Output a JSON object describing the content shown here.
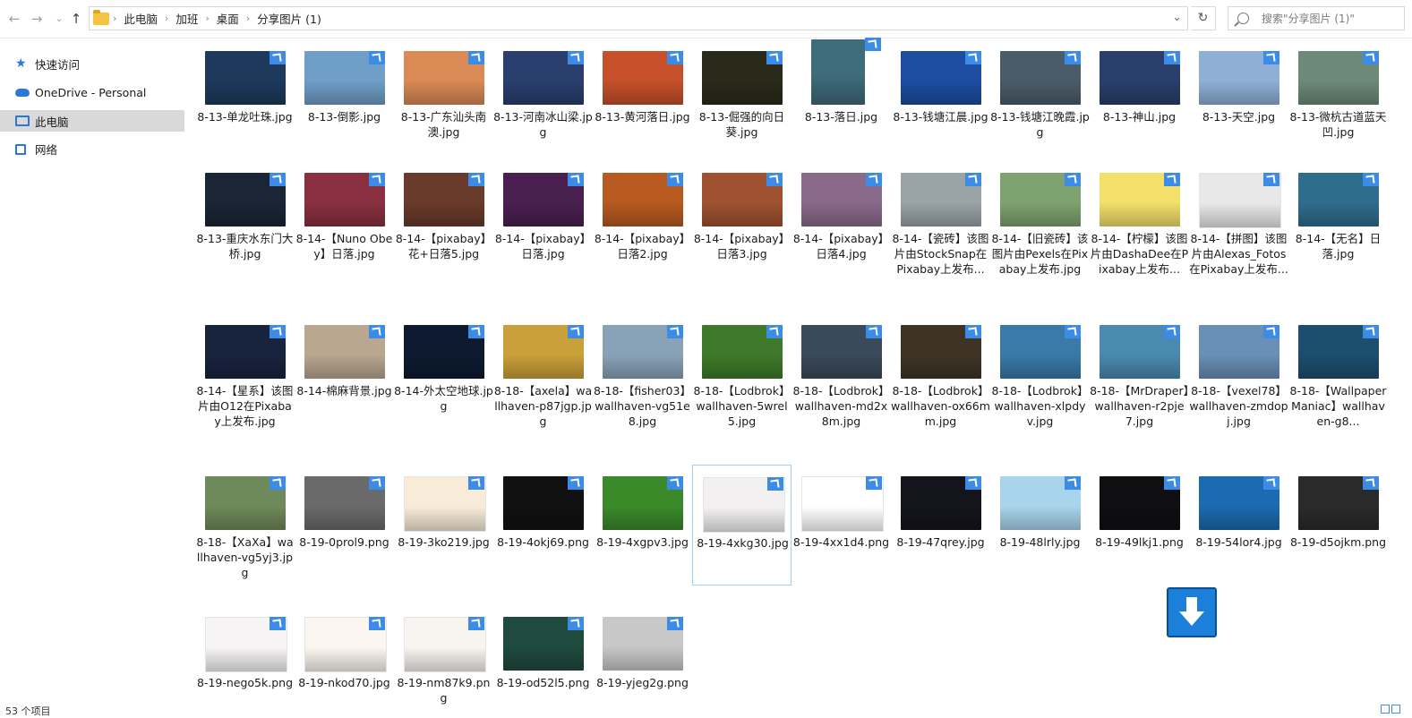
{
  "nav": {
    "back": "←",
    "forward": "→",
    "recent": "⌄",
    "up": "↑",
    "breadcrumb": [
      "此电脑",
      "加班",
      "桌面",
      "分享图片 (1)"
    ],
    "dropdown": "⌄",
    "refresh": "↻",
    "search_placeholder": "搜索\"分享图片 (1)\""
  },
  "sidebar": {
    "items": [
      {
        "label": "快速访问",
        "icon": "star-icon"
      },
      {
        "label": "OneDrive - Personal",
        "icon": "cloud-icon"
      },
      {
        "label": "此电脑",
        "icon": "computer-icon"
      },
      {
        "label": "网络",
        "icon": "network-icon"
      }
    ]
  },
  "files": [
    "8-13-单龙吐珠.jpg",
    "8-13-倒影.jpg",
    "8-13-广东汕头南澳.jpg",
    "8-13-河南冰山梁.jpg",
    "8-13-黄河落日.jpg",
    "8-13-倔强的向日葵.jpg",
    "8-13-落日.jpg",
    "8-13-钱塘江晨.jpg",
    "8-13-钱塘江晚霞.jpg",
    "8-13-神山.jpg",
    "8-13-天空.jpg",
    "8-13-微杭古道蓝天凹.jpg",
    "8-13-重庆水东门大桥.jpg",
    "8-14-【Nuno Obey】日落.jpg",
    "8-14-【pixabay】花+日落5.jpg",
    "8-14-【pixabay】日落.jpg",
    "8-14-【pixabay】日落2.jpg",
    "8-14-【pixabay】日落3.jpg",
    "8-14-【pixabay】日落4.jpg",
    "8-14-【瓷砖】该图片由StockSnap在Pixabay上发布...",
    "8-14-【旧瓷砖】该图片由Pexels在Pixabay上发布.jpg",
    "8-14-【柠檬】该图片由DashaDee在Pixabay上发布...",
    "8-14-【拼图】该图片由Alexas_Fotos在Pixabay上发布...",
    "8-14-【无名】日落.jpg",
    "8-14-【星系】该图片由O12在Pixabay上发布.jpg",
    "8-14-棉麻背景.jpg",
    "8-14-外太空地球.jpg",
    "8-18-【axela】wallhaven-p87jgp.jpg",
    "8-18-【fisher03】wallhaven-vg51e8.jpg",
    "8-18-【Lodbrok】wallhaven-5wrel5.jpg",
    "8-18-【Lodbrok】wallhaven-md2x8m.jpg",
    "8-18-【Lodbrok】wallhaven-ox66mm.jpg",
    "8-18-【Lodbrok】wallhaven-xlpdyv.jpg",
    "8-18-【MrDraper】wallhaven-r2pje7.jpg",
    "8-18-【vexel78】wallhaven-zmdopj.jpg",
    "8-18-【WallpaperManiac】wallhaven-g8...",
    "8-18-【XaXa】wallhaven-vg5yj3.jpg",
    "8-19-0prol9.png",
    "8-19-3ko219.jpg",
    "8-19-4okj69.png",
    "8-19-4xgpv3.jpg",
    "8-19-4xkg30.jpg",
    "8-19-4xx1d4.png",
    "8-19-47qrey.jpg",
    "8-19-48lrly.jpg",
    "8-19-49lkj1.png",
    "8-19-54lor4.jpg",
    "8-19-d5ojkm.png",
    "8-19-nego5k.png",
    "8-19-nkod70.jpg",
    "8-19-nm87k9.png",
    "8-19-od52l5.png",
    "8-19-yjeg2g.png"
  ],
  "thumb_colors": [
    "#1d3a5c",
    "#6f9ec8",
    "#d98a55",
    "#2a3f6e",
    "#c7502b",
    "#2a2a1a",
    "#3f6c7a",
    "#1c4da1",
    "#4a5c6a",
    "#2a3f6b",
    "#8fb0d6",
    "#6d8a78",
    "#1a2536",
    "#8a3040",
    "#6a3a2a",
    "#4a2050",
    "#b85a20",
    "#a05230",
    "#8a6a8a",
    "#9aa3a8",
    "#7ea370",
    "#f3e06a",
    "#e8e8e8",
    "#2f6d8c",
    "#18233e",
    "#b9a790",
    "#0d1a30",
    "#caa03a",
    "#8aa2b8",
    "#3f7a2a",
    "#3a4a5a",
    "#3e3426",
    "#3a7aa8",
    "#4a8ab0",
    "#6a90b8",
    "#1e4e6e",
    "#6f8a5a",
    "#6a6a6a",
    "#f8ecd8",
    "#111111",
    "#3a8a2a",
    "#f2f0f0",
    "#ffffff",
    "#14141c",
    "#a9d5ec",
    "#0f0f12",
    "#1a6bb0",
    "#2a2a2a",
    "#f6f4f4",
    "#fbf6f0",
    "#f8f4f0",
    "#1f4a3e",
    "#c8c8c8"
  ],
  "selected_index": 41,
  "status": "53 个项目"
}
